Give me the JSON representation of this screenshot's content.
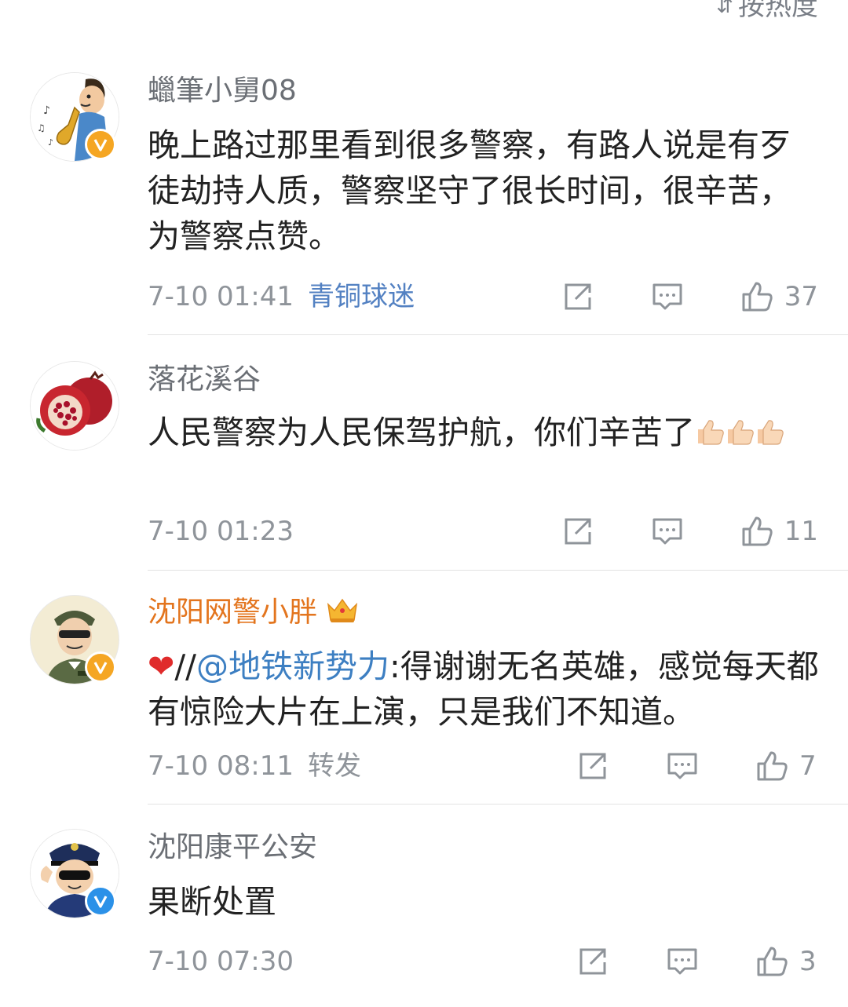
{
  "sort_label": "按热度",
  "comments": [
    {
      "username": "蠟筆小舅08",
      "text": "晚上路过那里看到很多警察，有路人说是有歹徒劫持人质，警察坚守了很长时间，很辛苦，为警察点赞。",
      "time": "7-10 01:41",
      "source": "青铜球迷",
      "likes": "37",
      "verified": "yellow"
    },
    {
      "username": "落花溪谷",
      "text": "人民警察为人民保驾护航，你们辛苦了",
      "time": "7-10 01:23",
      "likes": "11"
    },
    {
      "username": "沈阳网警小胖",
      "mention": "@地铁新势力",
      "slashes": "//",
      "text": ":得谢谢无名英雄，感觉每天都有惊险大片在上演，只是我们不知道。",
      "time": "7-10 08:11",
      "source": "转发",
      "likes": "7",
      "verified": "yellow"
    },
    {
      "username": "沈阳康平公安",
      "text": "果断处置",
      "time": "7-10 07:30",
      "likes": "3",
      "verified": "blue"
    }
  ],
  "colors": {
    "mention": "#3d7fc2",
    "source_link": "#5381c2",
    "vip_name": "#e3751e",
    "verified_yellow": "#f5a623",
    "verified_blue": "#2b91e8"
  }
}
